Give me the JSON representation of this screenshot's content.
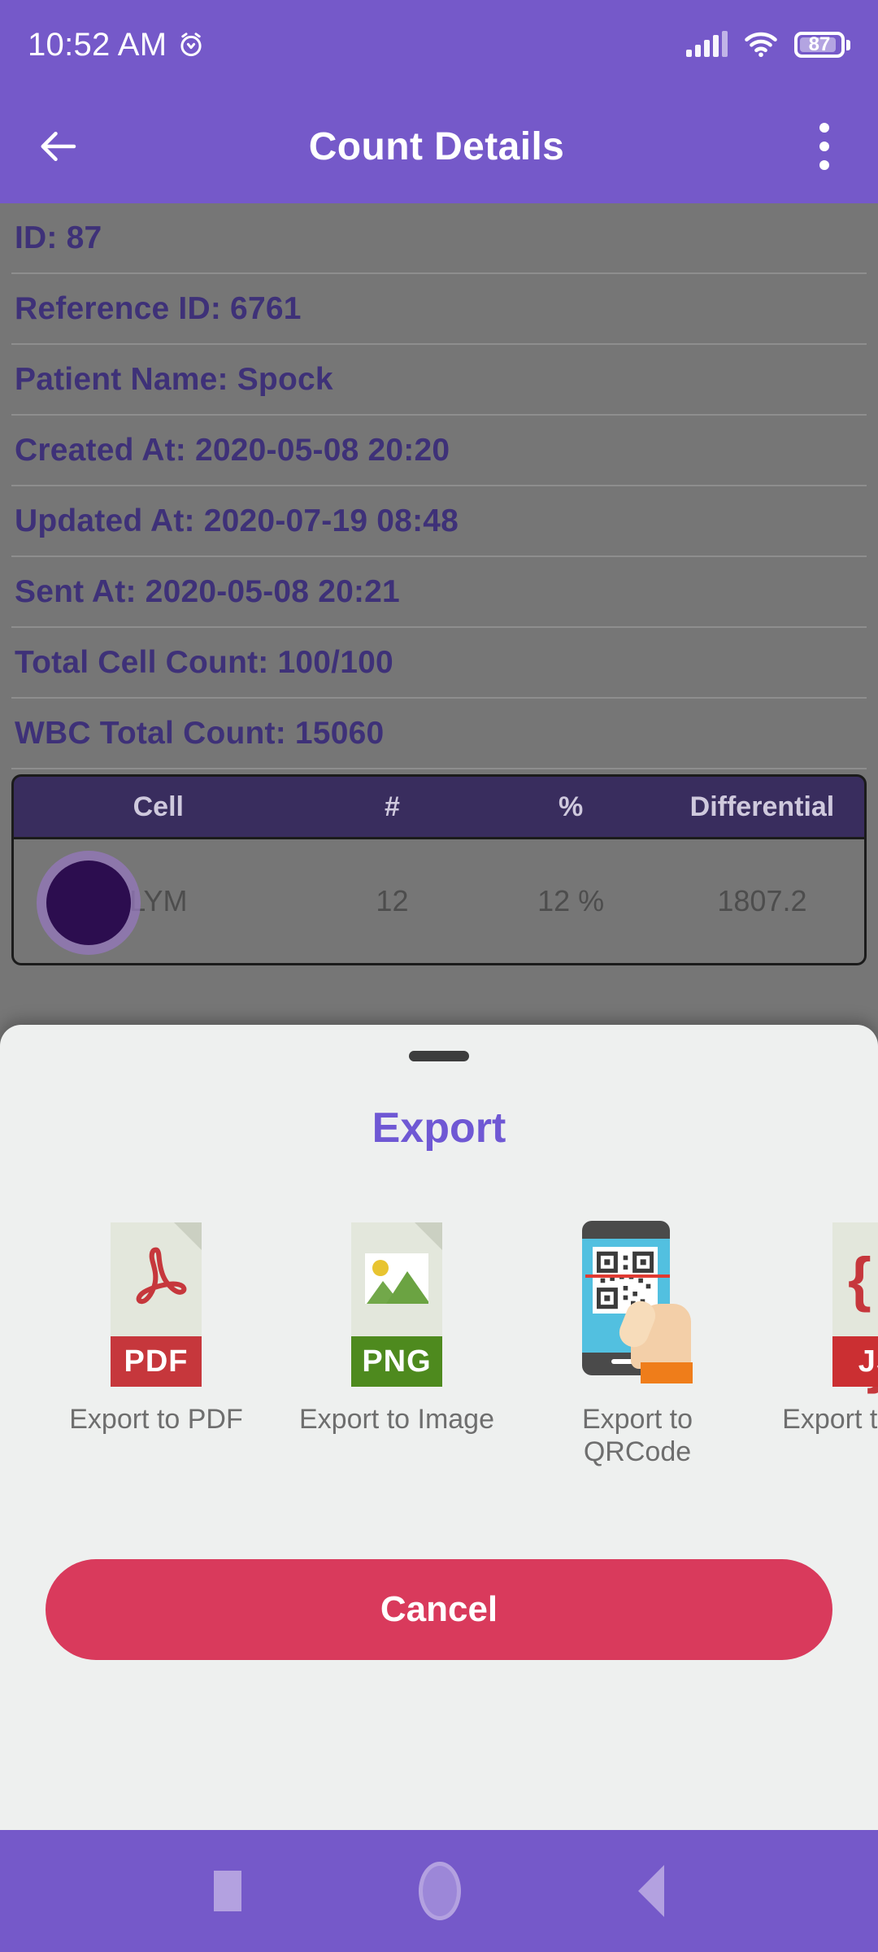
{
  "status_bar": {
    "time": "10:52 AM",
    "alarm_icon": "alarm-clock-icon",
    "signal_icon": "cellular-signal-icon",
    "wifi_icon": "wifi-icon",
    "battery_level": "87",
    "battery_icon": "battery-icon"
  },
  "app_bar": {
    "back_icon": "back-arrow-icon",
    "title": "Count Details",
    "overflow_icon": "more-vertical-icon"
  },
  "details": [
    {
      "text": "ID: 87"
    },
    {
      "text": "Reference ID: 6761"
    },
    {
      "text": "Patient Name: Spock"
    },
    {
      "text": "Created At: 2020-05-08 20:20"
    },
    {
      "text": "Updated At: 2020-07-19 08:48"
    },
    {
      "text": "Sent At: 2020-05-08 20:21"
    },
    {
      "text": "Total Cell Count: 100/100"
    },
    {
      "text": "WBC Total Count: 15060"
    }
  ],
  "table": {
    "headers": {
      "cell": "Cell",
      "hash": "#",
      "pct": "%",
      "diff": "Differential"
    },
    "rows": [
      {
        "swatch_icon": "cell-color-dot-icon",
        "cell": "LYM",
        "hash": "12",
        "pct": "12 %",
        "diff": "1807.2"
      }
    ]
  },
  "sheet": {
    "handle_icon": "drag-handle-icon",
    "title": "Export",
    "options": [
      {
        "icon": "pdf-file-icon",
        "band": "PDF",
        "label": "Export to PDF"
      },
      {
        "icon": "png-image-file-icon",
        "band": "PNG",
        "label": "Export to Image"
      },
      {
        "icon": "qrcode-scan-phone-icon",
        "band": "",
        "label": "Export to QRCode"
      },
      {
        "icon": "json-file-icon",
        "band": "JS",
        "label": "Export to Token"
      }
    ],
    "cancel_label": "Cancel"
  },
  "nav_bar": {
    "recents_icon": "recents-square-icon",
    "home_icon": "home-circle-icon",
    "back_icon": "back-triangle-icon"
  },
  "colors": {
    "primary_purple": "#7559c9",
    "table_header_purple": "#392d5e",
    "detail_text_indigo": "#3e3178",
    "sheet_title_purple": "#6f58d4",
    "cancel_pink": "#d93a5c",
    "scrim_gray": "#767676",
    "sheet_background": "#eef0ef"
  }
}
